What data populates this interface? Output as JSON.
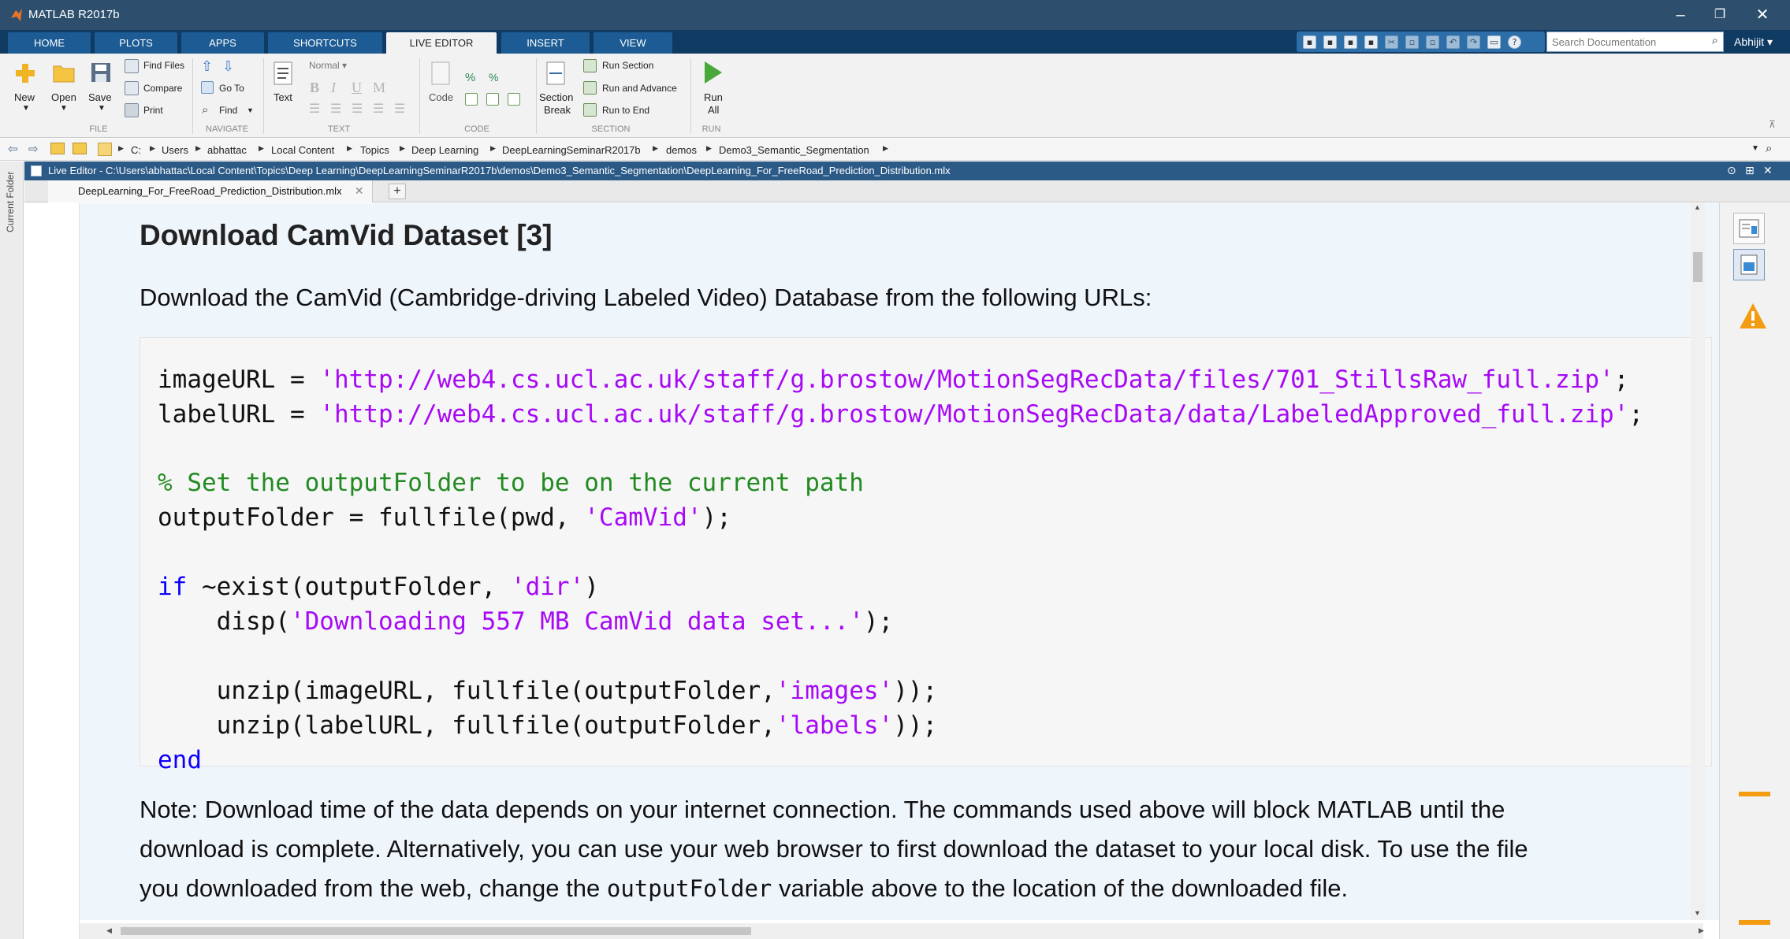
{
  "window": {
    "title": "MATLAB R2017b",
    "controls": [
      "–",
      "❐",
      "✕"
    ],
    "user": "Abhijit"
  },
  "ribbon_tabs": [
    "HOME",
    "PLOTS",
    "APPS",
    "SHORTCUTS",
    "LIVE EDITOR",
    "INSERT",
    "VIEW"
  ],
  "active_tab": "LIVE EDITOR",
  "search": {
    "placeholder": "Search Documentation"
  },
  "toolstrip": {
    "file": {
      "group": "FILE",
      "new": "New",
      "open": "Open",
      "save": "Save",
      "find_files": "Find Files",
      "compare": "Compare",
      "print": "Print"
    },
    "navigate": {
      "group": "NAVIGATE",
      "go_to": "Go To",
      "find": "Find"
    },
    "text": {
      "group": "TEXT",
      "text": "Text",
      "style": "Normal"
    },
    "code": {
      "group": "CODE",
      "code": "Code"
    },
    "section": {
      "group": "SECTION",
      "section_break": "Section",
      "section_break2": "Break",
      "run_section": "Run Section",
      "run_advance": "Run and Advance",
      "run_end": "Run to End"
    },
    "run": {
      "group": "RUN",
      "run_all": "Run",
      "run_all2": "All"
    }
  },
  "address": [
    "C:",
    "Users",
    "abhattac",
    "Local Content",
    "Topics",
    "Deep Learning",
    "DeepLearningSeminarR2017b",
    "demos",
    "Demo3_Semantic_Segmentation"
  ],
  "side_label": "Current Folder",
  "editor": {
    "title": "Live Editor - C:\\Users\\abhattac\\Local Content\\Topics\\Deep Learning\\DeepLearningSeminarR2017b\\demos\\Demo3_Semantic_Segmentation\\DeepLearning_For_FreeRoad_Prediction_Distribution.mlx",
    "tab": "DeepLearning_For_FreeRoad_Prediction_Distribution.mlx"
  },
  "document": {
    "heading": "Download CamVid Dataset [3]",
    "intro": "Download the CamVid (Cambridge-driving Labeled Video) Database from the following URLs:",
    "code": {
      "l1_a": "imageURL = ",
      "l1_s": "'http://web4.cs.ucl.ac.uk/staff/g.brostow/MotionSegRecData/files/701_StillsRaw_full.zip'",
      "l1_b": ";",
      "l2_a": "labelURL = ",
      "l2_s": "'http://web4.cs.ucl.ac.uk/staff/g.brostow/MotionSegRecData/data/LabeledApproved_full.zip'",
      "l2_b": ";",
      "l3_c": "% Set the outputFolder to be on the current path",
      "l4_a": "outputFolder = fullfile(pwd, ",
      "l4_s": "'CamVid'",
      "l4_b": ");",
      "l5_k": "if",
      "l5_a": " ~exist(outputFolder, ",
      "l5_s": "'dir'",
      "l5_b": ")",
      "l6_a": "    disp(",
      "l6_s": "'Downloading 557 MB CamVid data set...'",
      "l6_b": ");",
      "l7_a": "    unzip(imageURL, fullfile(outputFolder,",
      "l7_s": "'images'",
      "l7_b": "));",
      "l8_a": "    unzip(labelURL, fullfile(outputFolder,",
      "l8_s": "'labels'",
      "l8_b": "));",
      "l9_k": "end"
    },
    "note_1": "Note: Download time of the data depends on your internet connection. The commands used above will block MATLAB until the",
    "note_2": "download is complete. Alternatively, you can use your web browser to first download the dataset to your local disk. To use the file",
    "note_3a": "you downloaded from the web, change the ",
    "note_3m": "outputFolder",
    "note_3b": " variable above to the location of the downloaded file."
  },
  "colors": {
    "title_bar": "#2d4f6d",
    "ribbon": "#0f3a62",
    "keyword": "#0e00ff",
    "string": "#a709f5",
    "comment": "#228b22",
    "warning": "#f39c12"
  }
}
